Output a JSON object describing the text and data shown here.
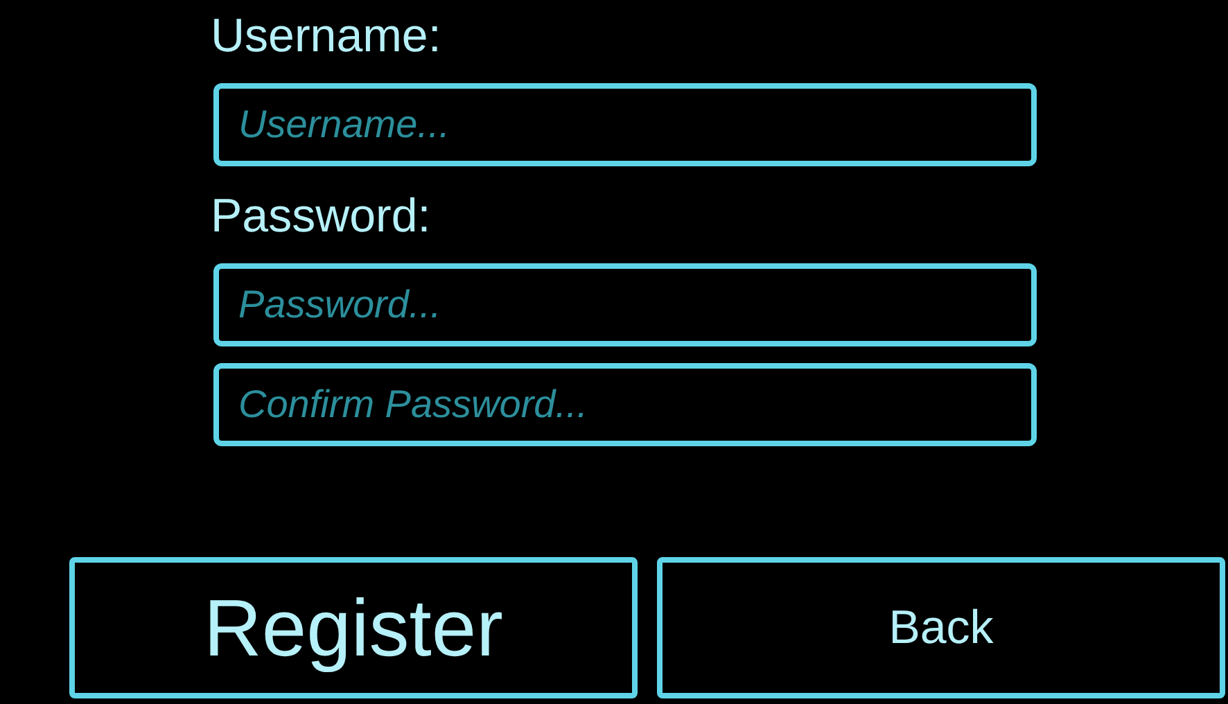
{
  "fields": [
    {
      "label": "Username:",
      "placeholder": "Username..."
    },
    {
      "label": "Password:",
      "placeholder": "Password..."
    },
    {
      "placeholder": "Confirm Password..."
    }
  ],
  "buttons": [
    {
      "label": "Register",
      "kind": "large"
    },
    {
      "label": "Back",
      "kind": "small"
    }
  ]
}
